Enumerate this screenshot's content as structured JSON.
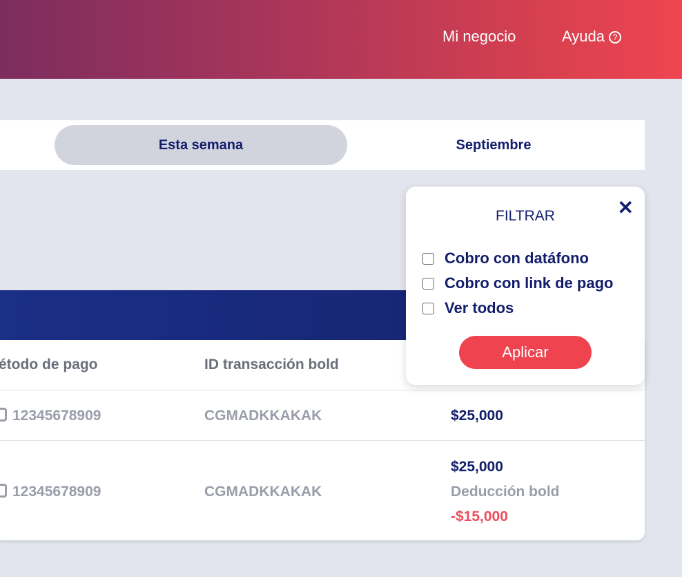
{
  "header": {
    "nav": [
      "Mi negocio",
      "Ayuda"
    ],
    "help_icon": "question-circle-icon"
  },
  "tabs": [
    "Esta semana",
    "Septiembre"
  ],
  "table": {
    "headers": [
      "étodo de pago",
      "ID transacción bold"
    ],
    "rows": [
      {
        "method": "12345678909",
        "id": "CGMADKKAKAK",
        "amount": "$25,000"
      },
      {
        "method": "12345678909",
        "id": "CGMADKKAKAK",
        "amount": "$25,000",
        "deduction_label": "Deducción bold",
        "deduction": "-$15,000"
      }
    ]
  },
  "filter": {
    "title": "FILTRAR",
    "options": [
      "Cobro con datáfono",
      "Cobro con link de pago",
      "Ver todos"
    ],
    "apply": "Aplicar"
  }
}
